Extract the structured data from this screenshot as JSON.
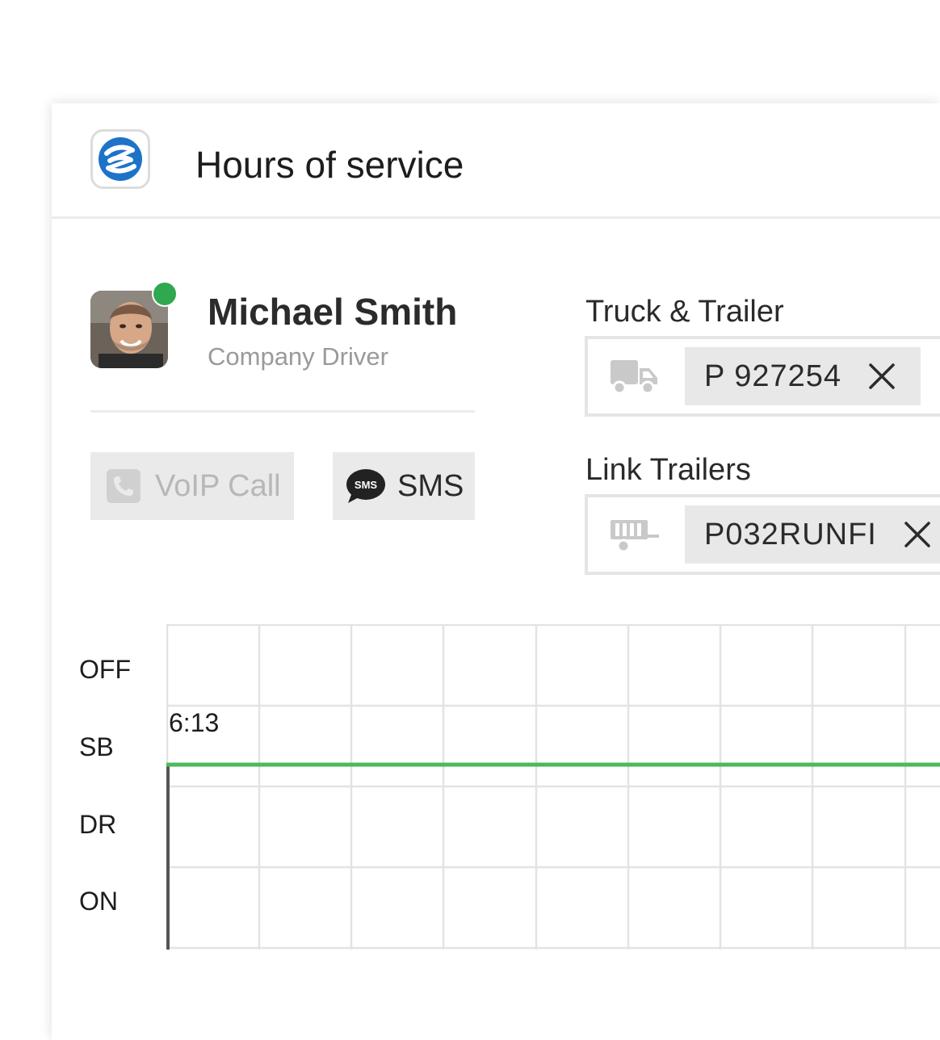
{
  "header": {
    "title": "Hours of service",
    "logo_icon": "company-logo-icon"
  },
  "driver": {
    "name": "Michael Smith",
    "role": "Company Driver",
    "status": "online",
    "status_color": "#2fa84f"
  },
  "actions": {
    "voip_label": "VoIP Call",
    "voip_icon": "phone-icon",
    "voip_enabled": false,
    "sms_label": "SMS",
    "sms_icon": "sms-bubble-icon"
  },
  "truck_trailer": {
    "label": "Truck & Trailer",
    "icon": "truck-icon",
    "value": "P 927254"
  },
  "link_trailers": {
    "label": "Link Trailers",
    "icon": "trailer-icon",
    "value": "P032RUNFI"
  },
  "log_chart": {
    "rows": [
      "OFF",
      "SB",
      "DR",
      "ON"
    ],
    "current_status": "SB",
    "status_start_time": "6:13",
    "status_line_color": "#4cb95e"
  }
}
